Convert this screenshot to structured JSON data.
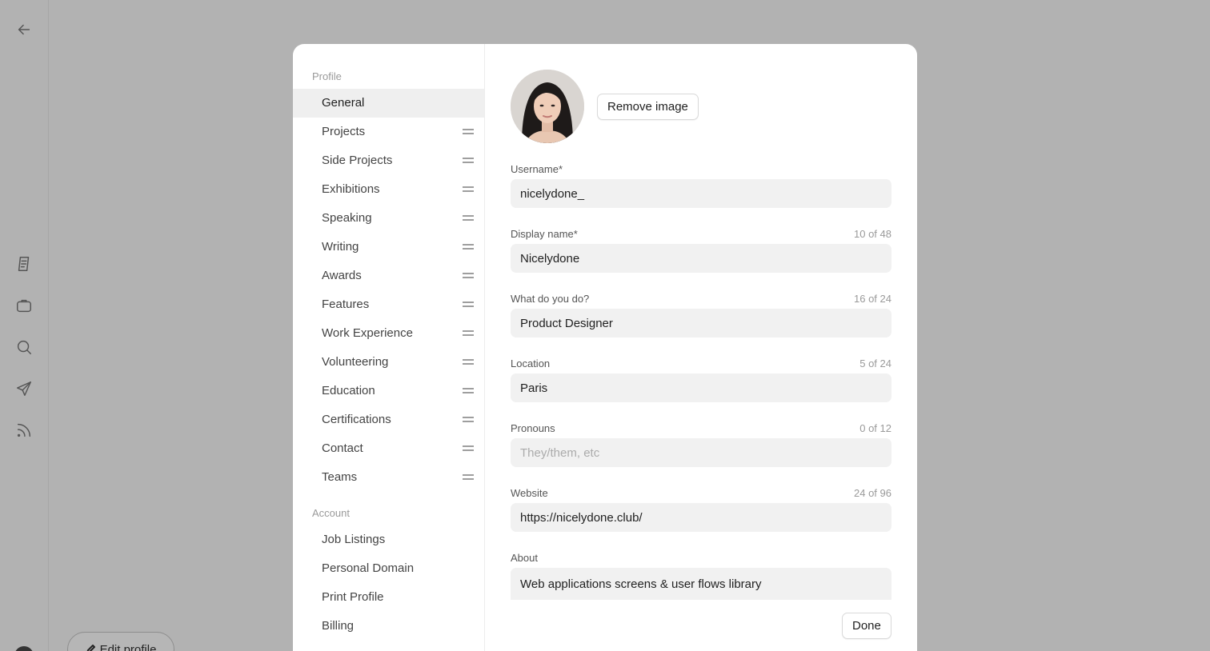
{
  "sidebar_profile_heading": "Profile",
  "profile_items": [
    {
      "label": "General"
    },
    {
      "label": "Projects"
    },
    {
      "label": "Side Projects"
    },
    {
      "label": "Exhibitions"
    },
    {
      "label": "Speaking"
    },
    {
      "label": "Writing"
    },
    {
      "label": "Awards"
    },
    {
      "label": "Features"
    },
    {
      "label": "Work Experience"
    },
    {
      "label": "Volunteering"
    },
    {
      "label": "Education"
    },
    {
      "label": "Certifications"
    },
    {
      "label": "Contact"
    },
    {
      "label": "Teams"
    }
  ],
  "sidebar_account_heading": "Account",
  "account_items": [
    {
      "label": "Job Listings"
    },
    {
      "label": "Personal Domain"
    },
    {
      "label": "Print Profile"
    },
    {
      "label": "Billing"
    }
  ],
  "remove_image_label": "Remove image",
  "fields": {
    "username": {
      "label": "Username*",
      "value": "nicelydone_"
    },
    "display_name": {
      "label": "Display name*",
      "count": "10 of 48",
      "value": "Nicelydone"
    },
    "what_do_you_do": {
      "label": "What do you do?",
      "count": "16 of 24",
      "value": "Product Designer"
    },
    "location": {
      "label": "Location",
      "count": "5 of 24",
      "value": "Paris"
    },
    "pronouns": {
      "label": "Pronouns",
      "count": "0 of 12",
      "value": "",
      "placeholder": "They/them, etc"
    },
    "website": {
      "label": "Website",
      "count": "24 of 96",
      "value": "https://nicelydone.club/"
    },
    "about": {
      "label": "About",
      "value": "Web applications screens & user flows library"
    }
  },
  "done_label": "Done",
  "edit_profile_label": "Edit profile",
  "icons": {
    "rail": [
      "back-arrow-icon",
      "document-icon",
      "briefcase-icon",
      "search-icon",
      "send-icon",
      "rss-icon"
    ],
    "drag": "drag-handle-icon"
  },
  "colors": {
    "backdrop": "#b2b2b2",
    "modal": "#ffffff",
    "input_bg": "#f1f1f1",
    "active_item_bg": "#efefef"
  }
}
